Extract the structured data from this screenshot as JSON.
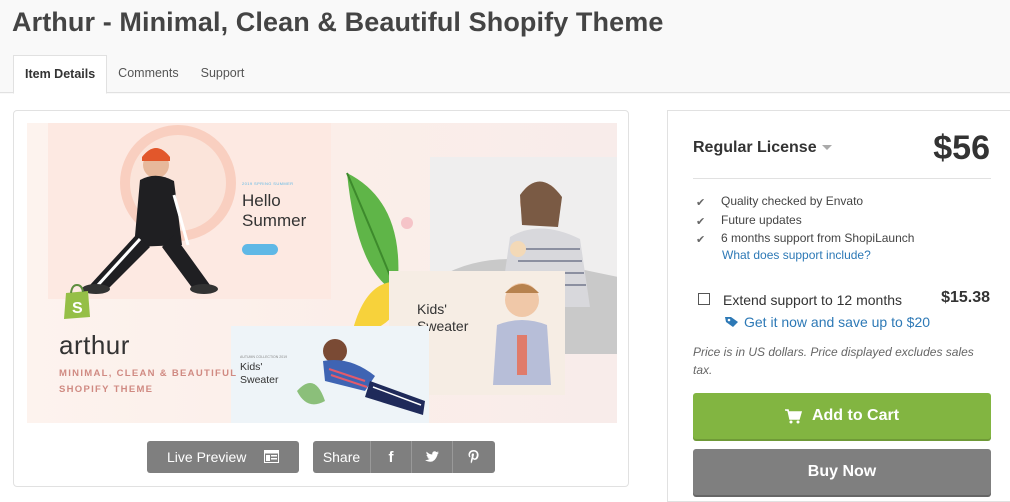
{
  "header": {
    "title": "Arthur - Minimal, Clean & Beautiful Shopify Theme",
    "tabs": [
      {
        "label": "Item Details",
        "active": true
      },
      {
        "label": "Comments",
        "active": false
      },
      {
        "label": "Support",
        "active": false
      }
    ]
  },
  "preview": {
    "hello_small": "2019 SPRING SUMMER",
    "hello_line1": "Hello",
    "hello_line2": "Summer",
    "brand_name": "arthur",
    "brand_tag_line1": "MINIMAL, CLEAN & BEAUTIFUL",
    "brand_tag_line2": "SHOPIFY THEME",
    "kids1_line1": "Kids'",
    "kids1_line2": "Sweater",
    "kids2_small": "AUTUMN COLLECTION 2019",
    "kids2_line1": "Kids'",
    "kids2_line2": "Sweater"
  },
  "actions": {
    "live_preview": "Live Preview",
    "share": "Share"
  },
  "license": {
    "name": "Regular License",
    "price": "$56",
    "features": [
      "Quality checked by Envato",
      "Future updates",
      "6 months support from ShopiLaunch"
    ],
    "support_link": "What does support include?",
    "extend_label": "Extend support to 12 months",
    "extend_price": "$15.38",
    "save_link": "Get it now and save up to $20",
    "price_note": "Price is in US dollars. Price displayed excludes sales tax.",
    "add_to_cart": "Add to Cart",
    "buy_now": "Buy Now"
  },
  "colors": {
    "cart_green": "#82b541",
    "link_blue": "#2d79b6",
    "button_gray": "#7f7f7f"
  }
}
